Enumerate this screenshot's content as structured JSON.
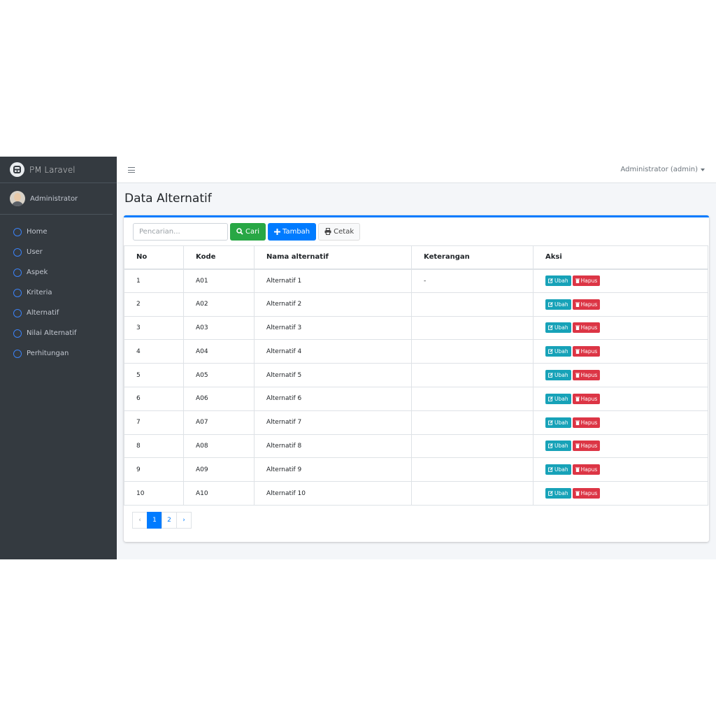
{
  "brand": {
    "name": "PM Laravel"
  },
  "user": {
    "name": "Administrator"
  },
  "sidebar": {
    "items": [
      {
        "label": "Home"
      },
      {
        "label": "User"
      },
      {
        "label": "Aspek"
      },
      {
        "label": "Kriteria"
      },
      {
        "label": "Alternatif"
      },
      {
        "label": "Nilai Alternatif"
      },
      {
        "label": "Perhitungan"
      }
    ]
  },
  "topbar": {
    "user_menu": "Administrator (admin)"
  },
  "page": {
    "title": "Data Alternatif"
  },
  "toolbar": {
    "search_placeholder": "Pencarian...",
    "search_label": "Cari",
    "add_label": "Tambah",
    "print_label": "Cetak"
  },
  "table": {
    "headers": [
      "No",
      "Kode",
      "Nama alternatif",
      "Keterangan",
      "Aksi"
    ],
    "edit_label": "Ubah",
    "delete_label": "Hapus",
    "rows": [
      {
        "no": "1",
        "kode": "A01",
        "nama": "Alternatif 1",
        "ket": "-"
      },
      {
        "no": "2",
        "kode": "A02",
        "nama": "Alternatif 2",
        "ket": ""
      },
      {
        "no": "3",
        "kode": "A03",
        "nama": "Alternatif 3",
        "ket": ""
      },
      {
        "no": "4",
        "kode": "A04",
        "nama": "Alternatif 4",
        "ket": ""
      },
      {
        "no": "5",
        "kode": "A05",
        "nama": "Alternatif 5",
        "ket": ""
      },
      {
        "no": "6",
        "kode": "A06",
        "nama": "Alternatif 6",
        "ket": ""
      },
      {
        "no": "7",
        "kode": "A07",
        "nama": "Alternatif 7",
        "ket": ""
      },
      {
        "no": "8",
        "kode": "A08",
        "nama": "Alternatif 8",
        "ket": ""
      },
      {
        "no": "9",
        "kode": "A09",
        "nama": "Alternatif 9",
        "ket": ""
      },
      {
        "no": "10",
        "kode": "A10",
        "nama": "Alternatif 10",
        "ket": ""
      }
    ]
  },
  "pagination": {
    "prev": "‹",
    "pages": [
      "1",
      "2"
    ],
    "next": "›",
    "active": "1"
  },
  "colors": {
    "primary": "#007bff",
    "success": "#28a745",
    "info": "#17a2b8",
    "danger": "#dc3545",
    "sidebar": "#343a40"
  }
}
